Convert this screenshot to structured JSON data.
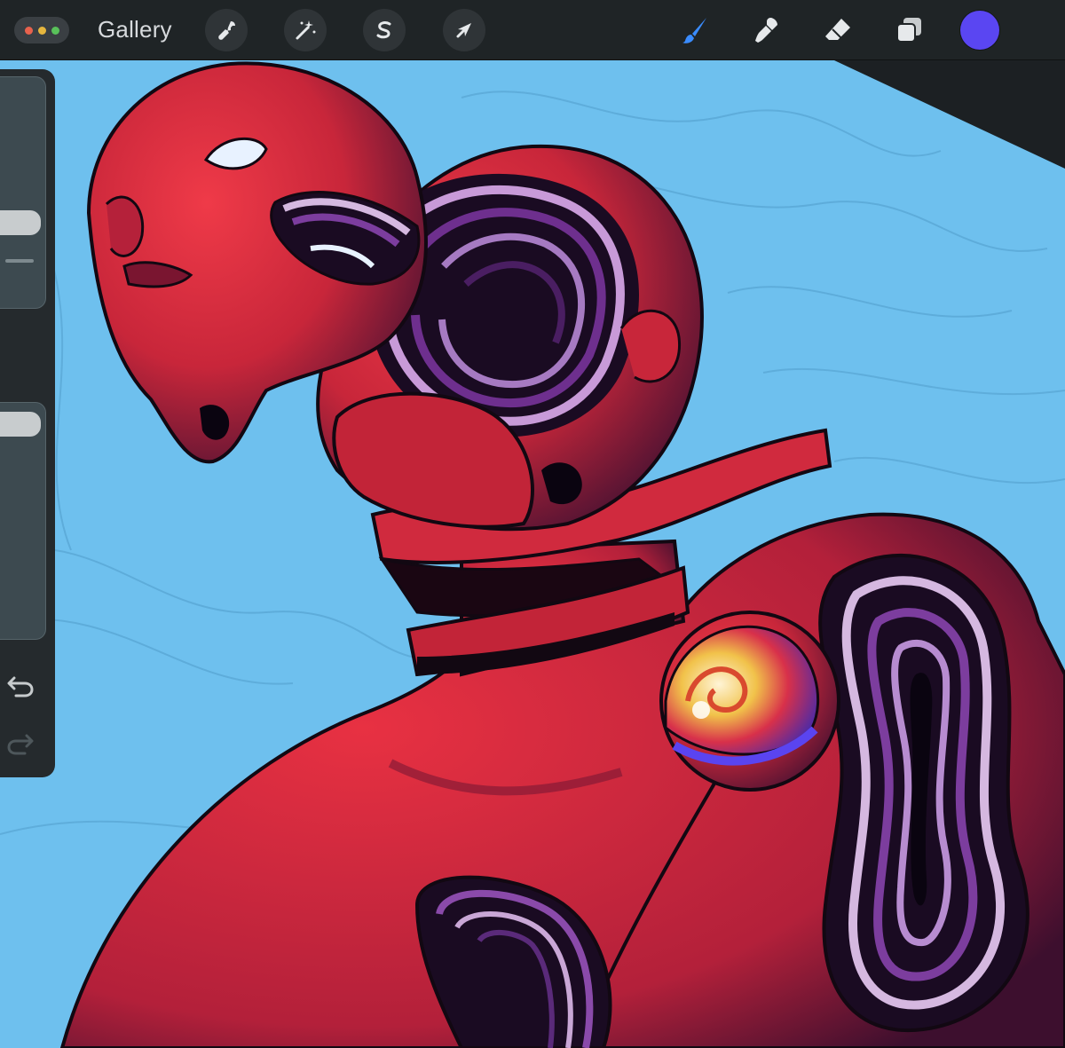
{
  "app": {
    "gallery_label": "Gallery",
    "window_dots": [
      "#e8624d",
      "#e6b63e",
      "#59c15a"
    ]
  },
  "toolbar": {
    "left_tools": [
      {
        "name": "actions",
        "icon": "wrench-icon"
      },
      {
        "name": "adjustments",
        "icon": "magic-wand-icon"
      },
      {
        "name": "selection",
        "icon": "selection-s-icon"
      },
      {
        "name": "transform",
        "icon": "arrow-cursor-icon"
      }
    ],
    "right_tools": [
      {
        "name": "brush",
        "icon": "brush-icon",
        "active": true
      },
      {
        "name": "smudge",
        "icon": "smudge-icon"
      },
      {
        "name": "eraser",
        "icon": "eraser-icon"
      },
      {
        "name": "layers",
        "icon": "layers-icon"
      }
    ],
    "current_color": "#5a46f2",
    "accent_color": "#3a8cff"
  },
  "sidebar": {
    "brush_size_level": 0.28,
    "opacity_level": 0.07,
    "modifier_icon": "square-modifier-icon",
    "undo_icon": "undo-icon",
    "redo_icon": "redo-icon"
  },
  "canvas": {
    "background_color": "#6ec0ee",
    "figure_color": "#e0303c",
    "shadow_color": "#3a1030"
  }
}
